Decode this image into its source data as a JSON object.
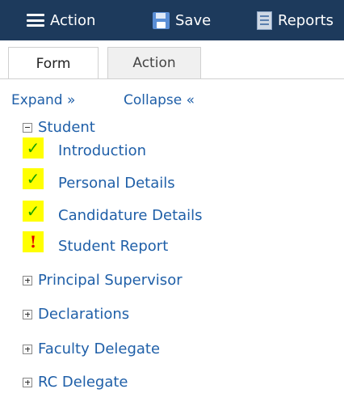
{
  "toolbar": {
    "action_label": "Action",
    "save_label": "Save",
    "reports_label": "Reports"
  },
  "tabs": [
    {
      "label": "Form",
      "active": true
    },
    {
      "label": "Action",
      "active": false
    }
  ],
  "tree_controls": {
    "expand": "Expand »",
    "collapse": "Collapse «"
  },
  "tree": {
    "student": {
      "label": "Student",
      "expanded": true,
      "children": [
        {
          "label": "Introduction",
          "status": "complete",
          "status_glyph": "✓"
        },
        {
          "label": "Personal Details",
          "status": "complete",
          "status_glyph": "✓"
        },
        {
          "label": "Candidature Details",
          "status": "complete",
          "status_glyph": "✓"
        },
        {
          "label": "Student Report",
          "status": "error",
          "status_glyph": "!"
        }
      ]
    },
    "collapsed": [
      {
        "label": "Principal Supervisor"
      },
      {
        "label": "Declarations"
      },
      {
        "label": "Faculty Delegate"
      },
      {
        "label": "RC Delegate"
      }
    ]
  },
  "colors": {
    "toolbar_bg": "#1d3a5c",
    "link": "#1f5fa8",
    "status_highlight": "#ffff00",
    "check": "#1aa000",
    "error": "#e00000"
  }
}
